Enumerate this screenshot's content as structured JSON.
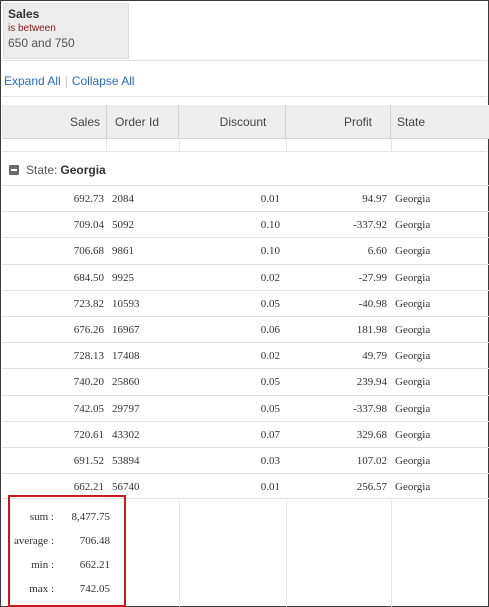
{
  "filter": {
    "field": "Sales",
    "operator": "is between",
    "value": "650 and 750"
  },
  "actions": {
    "expand_all": "Expand All",
    "collapse_all": "Collapse All",
    "separator": "|"
  },
  "table": {
    "columns": [
      "Sales",
      "Order Id",
      "Discount",
      "Profit",
      "State"
    ],
    "group": {
      "label": "State:",
      "value": "Georgia"
    },
    "rows": [
      {
        "sales": "692.73",
        "order_id": "2084",
        "discount": "0.01",
        "profit": "94.97",
        "state": "Georgia"
      },
      {
        "sales": "709.04",
        "order_id": "5092",
        "discount": "0.10",
        "profit": "-337.92",
        "state": "Georgia"
      },
      {
        "sales": "706.68",
        "order_id": "9861",
        "discount": "0.10",
        "profit": "6.60",
        "state": "Georgia"
      },
      {
        "sales": "684.50",
        "order_id": "9925",
        "discount": "0.02",
        "profit": "-27.99",
        "state": "Georgia"
      },
      {
        "sales": "723.82",
        "order_id": "10593",
        "discount": "0.05",
        "profit": "-40.98",
        "state": "Georgia"
      },
      {
        "sales": "676.26",
        "order_id": "16967",
        "discount": "0.06",
        "profit": "181.98",
        "state": "Georgia"
      },
      {
        "sales": "728.13",
        "order_id": "17408",
        "discount": "0.02",
        "profit": "49.79",
        "state": "Georgia"
      },
      {
        "sales": "740.20",
        "order_id": "25860",
        "discount": "0.05",
        "profit": "239.94",
        "state": "Georgia"
      },
      {
        "sales": "742.05",
        "order_id": "29797",
        "discount": "0.05",
        "profit": "-337.98",
        "state": "Georgia"
      },
      {
        "sales": "720.61",
        "order_id": "43302",
        "discount": "0.07",
        "profit": "329.68",
        "state": "Georgia"
      },
      {
        "sales": "691.52",
        "order_id": "53894",
        "discount": "0.03",
        "profit": "107.02",
        "state": "Georgia"
      },
      {
        "sales": "662.21",
        "order_id": "56740",
        "discount": "0.01",
        "profit": "256.57",
        "state": "Georgia"
      }
    ],
    "summary": [
      {
        "label": "sum :",
        "value": "8,477.75"
      },
      {
        "label": "average :",
        "value": "706.48"
      },
      {
        "label": "min :",
        "value": "662.21"
      },
      {
        "label": "max :",
        "value": "742.05"
      }
    ]
  },
  "colors": {
    "link": "#2a6ebb",
    "header_bg": "#eeeeee",
    "summary_border": "#c8171e",
    "filter_operator": "#8b1a1a"
  },
  "icons": {
    "group_toggle": "collapse-minus-icon"
  }
}
